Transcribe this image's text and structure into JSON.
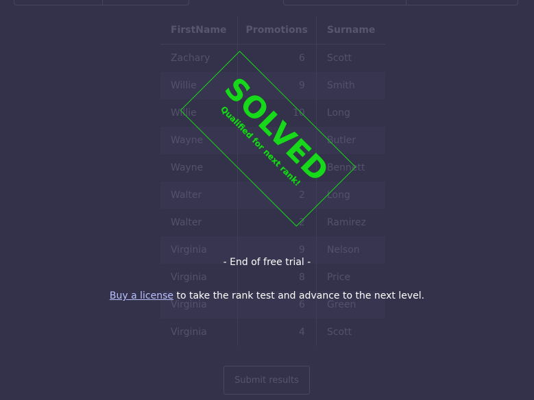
{
  "table": {
    "headers": {
      "first_name": "FirstName",
      "promotions": "Promotions",
      "surname": "Surname"
    },
    "rows": [
      {
        "first_name": "Zachary",
        "promotions": "6",
        "surname": "Scott"
      },
      {
        "first_name": "Willie",
        "promotions": "9",
        "surname": "Smith"
      },
      {
        "first_name": "Willie",
        "promotions": "10",
        "surname": "Long"
      },
      {
        "first_name": "Wayne",
        "promotions": "",
        "surname": "Butler"
      },
      {
        "first_name": "Wayne",
        "promotions": "",
        "surname": "Bennett"
      },
      {
        "first_name": "Walter",
        "promotions": "2",
        "surname": "Long"
      },
      {
        "first_name": "Walter",
        "promotions": "2",
        "surname": "Ramirez"
      },
      {
        "first_name": "Virginia",
        "promotions": "9",
        "surname": "Nelson"
      },
      {
        "first_name": "Virginia",
        "promotions": "8",
        "surname": "Price"
      },
      {
        "first_name": "Virginia",
        "promotions": "6",
        "surname": "Green"
      },
      {
        "first_name": "Virginia",
        "promotions": "4",
        "surname": "Scott"
      }
    ]
  },
  "stamp": {
    "title": "SOLVED",
    "subtitle": "Qualified for next rank!",
    "color": "#18d81b"
  },
  "trial": {
    "end_text": "- End of free trial -",
    "link_text": "Buy a license",
    "suffix_text": " to take the rank test and advance to the next level.",
    "link_color": "#b9c0ff"
  },
  "buttons": {
    "submit_label": "Submit results"
  },
  "colors": {
    "background": "#34324a",
    "muted_text": "#54516d",
    "accent_green": "#18d81b"
  }
}
